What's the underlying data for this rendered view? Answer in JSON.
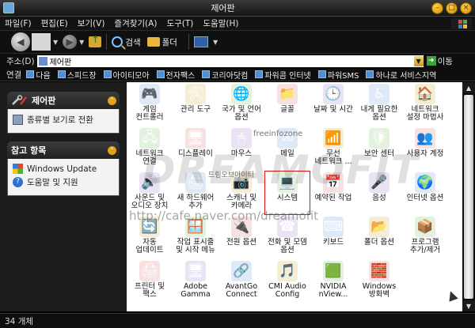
{
  "window": {
    "title": "제어판"
  },
  "menu": [
    "파일(F)",
    "편집(E)",
    "보기(V)",
    "즐겨찾기(A)",
    "도구(T)",
    "도움말(H)"
  ],
  "toolbar": {
    "search": "검색",
    "folders": "폴더"
  },
  "address": {
    "label": "주소(D)",
    "value": "제어판",
    "go": "이동"
  },
  "links": {
    "label": "연결",
    "items": [
      "다음",
      "스피드장",
      "아이티모아",
      "전자팩스",
      "코리아닷컴",
      "파워콤 인터넷",
      "파워SMS",
      "하나로 서비스지역"
    ]
  },
  "sidebar": {
    "panel1": {
      "title": "제어판",
      "switch_view": "종류별 보기로 전환"
    },
    "panel2": {
      "title": "참고 항목",
      "items": [
        "Windows Update",
        "도움말 및 지원"
      ]
    }
  },
  "items": [
    {
      "label": "게임\n컨트롤러",
      "icon": "gamepad-icon",
      "glyph": "🎮"
    },
    {
      "label": "관리 도구",
      "icon": "admin-tools-icon",
      "glyph": "🛠"
    },
    {
      "label": "국가 및 언어\n옵션",
      "icon": "globe-icon",
      "glyph": "🌐"
    },
    {
      "label": "글꼴",
      "icon": "font-folder-icon",
      "glyph": "📁"
    },
    {
      "label": "날짜 및 시간",
      "icon": "clock-icon",
      "glyph": "🕒"
    },
    {
      "label": "내게 필요한\n옵션",
      "icon": "accessibility-icon",
      "glyph": "♿"
    },
    {
      "label": "네트워크\n설정 마법사",
      "icon": "network-house-icon",
      "glyph": "🏠"
    },
    {
      "label": "네트워크\n연결",
      "icon": "network-icon",
      "glyph": "🖧"
    },
    {
      "label": "디스플레이",
      "icon": "monitor-icon",
      "glyph": "🖥"
    },
    {
      "label": "마우스",
      "icon": "mouse-icon",
      "glyph": "🖱"
    },
    {
      "label": "메일",
      "icon": "mail-icon",
      "glyph": "✉"
    },
    {
      "label": "무선\n네트워크 ...",
      "icon": "wireless-icon",
      "glyph": "📶"
    },
    {
      "label": "보안 센터",
      "icon": "shield-icon",
      "glyph": "🛡"
    },
    {
      "label": "사용자 계정",
      "icon": "users-icon",
      "glyph": "👥"
    },
    {
      "label": "사운드 및\n오디오 장치",
      "icon": "speaker-icon",
      "glyph": "🔊"
    },
    {
      "label": "새 하드웨어\n추가",
      "icon": "hardware-icon",
      "glyph": "🖨"
    },
    {
      "label": "스캐너 및\n카메라",
      "icon": "camera-icon",
      "glyph": "📷"
    },
    {
      "label": "시스템",
      "icon": "system-icon",
      "glyph": "💻"
    },
    {
      "label": "예약된 작업",
      "icon": "scheduled-task-icon",
      "glyph": "📅"
    },
    {
      "label": "음성",
      "icon": "speech-icon",
      "glyph": "🎤"
    },
    {
      "label": "인터넷 옵션",
      "icon": "internet-icon",
      "glyph": "🌍"
    },
    {
      "label": "자동\n업데이트",
      "icon": "update-icon",
      "glyph": "🔄"
    },
    {
      "label": "작업 표시줄\n및 시작 메뉴",
      "icon": "taskbar-icon",
      "glyph": "🪟"
    },
    {
      "label": "전원 옵션",
      "icon": "power-icon",
      "glyph": "🔌"
    },
    {
      "label": "전화 및 모뎀\n옵션",
      "icon": "phone-icon",
      "glyph": "☎"
    },
    {
      "label": "키보드",
      "icon": "keyboard-icon",
      "glyph": "⌨"
    },
    {
      "label": "폴더 옵션",
      "icon": "folder-options-icon",
      "glyph": "📂"
    },
    {
      "label": "프로그램\n추가/제거",
      "icon": "programs-icon",
      "glyph": "📦"
    },
    {
      "label": "프린터 및\n팩스",
      "icon": "printer-icon",
      "glyph": "🖨"
    },
    {
      "label": "Adobe\nGamma",
      "icon": "adobe-gamma-icon",
      "glyph": "🖥"
    },
    {
      "label": "AvantGo\nConnect",
      "icon": "avantgo-icon",
      "glyph": "🔗"
    },
    {
      "label": "CMI Audio\nConfig",
      "icon": "audio-config-icon",
      "glyph": "🎵"
    },
    {
      "label": "NVIDIA\nnView...",
      "icon": "nvidia-icon",
      "glyph": "🟩"
    },
    {
      "label": "Windows\n방화벽",
      "icon": "firewall-icon",
      "glyph": "🧱"
    }
  ],
  "watermark": {
    "site": "freeinfozone",
    "logo": "DREAMOFIT",
    "sub": "드림오브아이티",
    "url": "http://cafe.naver.com/dreamofit"
  },
  "status": {
    "count": "34 개체"
  }
}
